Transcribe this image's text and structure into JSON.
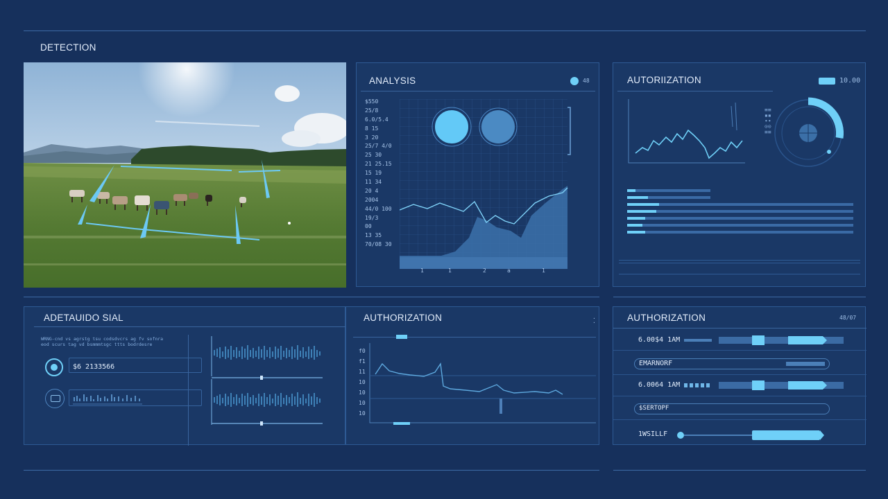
{
  "detection": {
    "title": "DETECTION"
  },
  "analysis": {
    "title": "ANALYSIS",
    "badge": "48",
    "ylabels": [
      "$550",
      "25/8",
      "6.0/5.4",
      "8 15",
      "3 20",
      "25/7 4/0",
      "25 30",
      "21 25.15",
      "15 19",
      "11 34",
      "20 4",
      "2004",
      "44/0 100",
      "19/3",
      "00",
      "13 35",
      "70/08 30"
    ],
    "xticks": [
      "1",
      "1",
      "2",
      "a",
      "1"
    ]
  },
  "autorization": {
    "title": "AUTORIIZATION",
    "value": "10.00"
  },
  "signal": {
    "title": "ADETAUIDO SIAL",
    "text": "WRNG-cnd vs agrstg tsu codsdvcrs ag fv sofnra eod scurs tag vd bsmmmtsgc ttts bodrdesre",
    "item1": "$6 2133566",
    "item2_icon": "camera-icon",
    "item1_icon": "target-icon"
  },
  "authorization_center": {
    "title": "AUTHORIZATION",
    "yticks": [
      "f0",
      "f1",
      "11",
      "10",
      "10",
      "10",
      "10"
    ]
  },
  "authorization_right": {
    "title": "AUTHORIZATION",
    "badge": "48/07",
    "rows": [
      {
        "label": "6.00$4 1AM"
      },
      {
        "label": "EMARNORF"
      },
      {
        "label": "6.0064 1AM"
      },
      {
        "label": "$SERTOPF"
      },
      {
        "label": "1WSILLF"
      }
    ]
  },
  "colors": {
    "accent": "#5fc9f8",
    "panel": "#1a3866",
    "background": "#16305c"
  }
}
